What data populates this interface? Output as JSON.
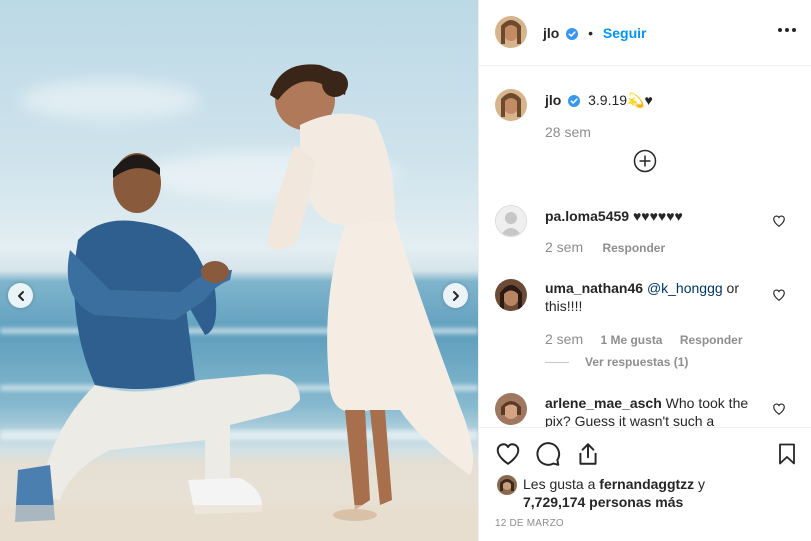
{
  "post": {
    "image_alt": "Proposal on the beach photo",
    "carousel": {
      "prev_icon": "chevron-left-icon",
      "next_icon": "chevron-right-icon"
    }
  },
  "header": {
    "username": "jlo",
    "verified": true,
    "separator": "•",
    "follow_label": "Seguir",
    "more_icon": "ellipsis-icon"
  },
  "caption": {
    "username": "jlo",
    "text": "3.9.19💫♥",
    "time": "28 sem",
    "load_more_icon": "plus-circle-icon"
  },
  "comments": [
    {
      "username": "pa.loma5459",
      "text": " ♥♥♥♥♥♥",
      "time": "2 sem",
      "likes": "",
      "reply": "Responder"
    },
    {
      "username": "uma_nathan46",
      "mention": "@k_honggg",
      "text": " or this!!!!",
      "time": "2 sem",
      "likes": "1 Me gusta",
      "reply": "Responder",
      "view_replies": "Ver respuestas (1)"
    },
    {
      "username": "arlene_mae_asch",
      "text": " Who took the pix? Guess it wasn't such a",
      "time": "",
      "likes": "",
      "reply": ""
    }
  ],
  "actions": {
    "like_icon": "heart-outline-icon",
    "comment_icon": "comment-icon",
    "share_icon": "share-icon",
    "save_icon": "bookmark-icon"
  },
  "likes": {
    "prefix": "Les gusta a ",
    "user": "fernandaggtzz",
    "middle": " y",
    "count": "7,729,174 personas más"
  },
  "date": "12 DE MARZO",
  "colors": {
    "link": "#0095f6",
    "verified": "#3897f0",
    "text": "#262626",
    "muted": "#8e8e8e"
  }
}
